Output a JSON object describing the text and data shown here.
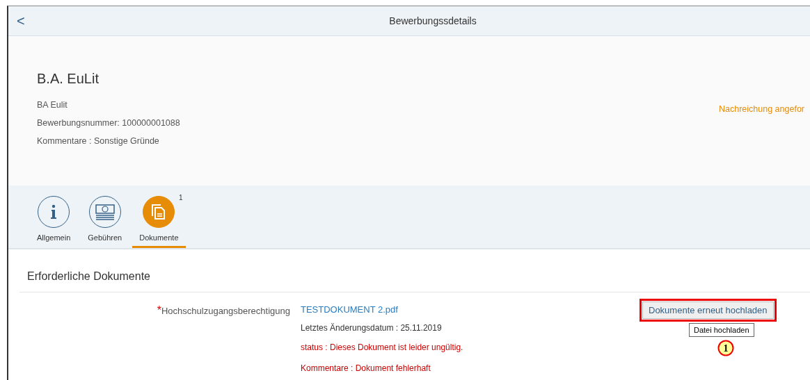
{
  "header": {
    "back": "<",
    "title": "Bewerbungssdetails"
  },
  "object": {
    "title": "B.A. EuLit",
    "lines": [
      "BA Eulit",
      "Bewerbungsnummer: 100000001088",
      "Kommentare : Sonstige Gründe"
    ],
    "status": "Nachreichung angefor"
  },
  "tabs": [
    {
      "label": "Allgemein",
      "kind": "info",
      "selected": false
    },
    {
      "label": "Gebühren",
      "kind": "money",
      "selected": false
    },
    {
      "label": "Dokumente",
      "kind": "documents",
      "selected": true,
      "count": "1"
    }
  ],
  "section": {
    "title": "Erforderliche Dokumente",
    "documents": [
      {
        "required": true,
        "required_mark": "*",
        "label": "Hochschulzugangsberechtigung",
        "file": "TESTDOKUMENT 2.pdf",
        "date": "Letztes Änderungsdatum : 25.11.2019",
        "status": "status : Dieses Dokument ist leider ungültig.",
        "comment": "Kommentare : Dokument fehlerhaft",
        "button": "Dokumente erneut hochladen",
        "tooltip": "Datei hochladen",
        "callout": "1"
      }
    ]
  }
}
